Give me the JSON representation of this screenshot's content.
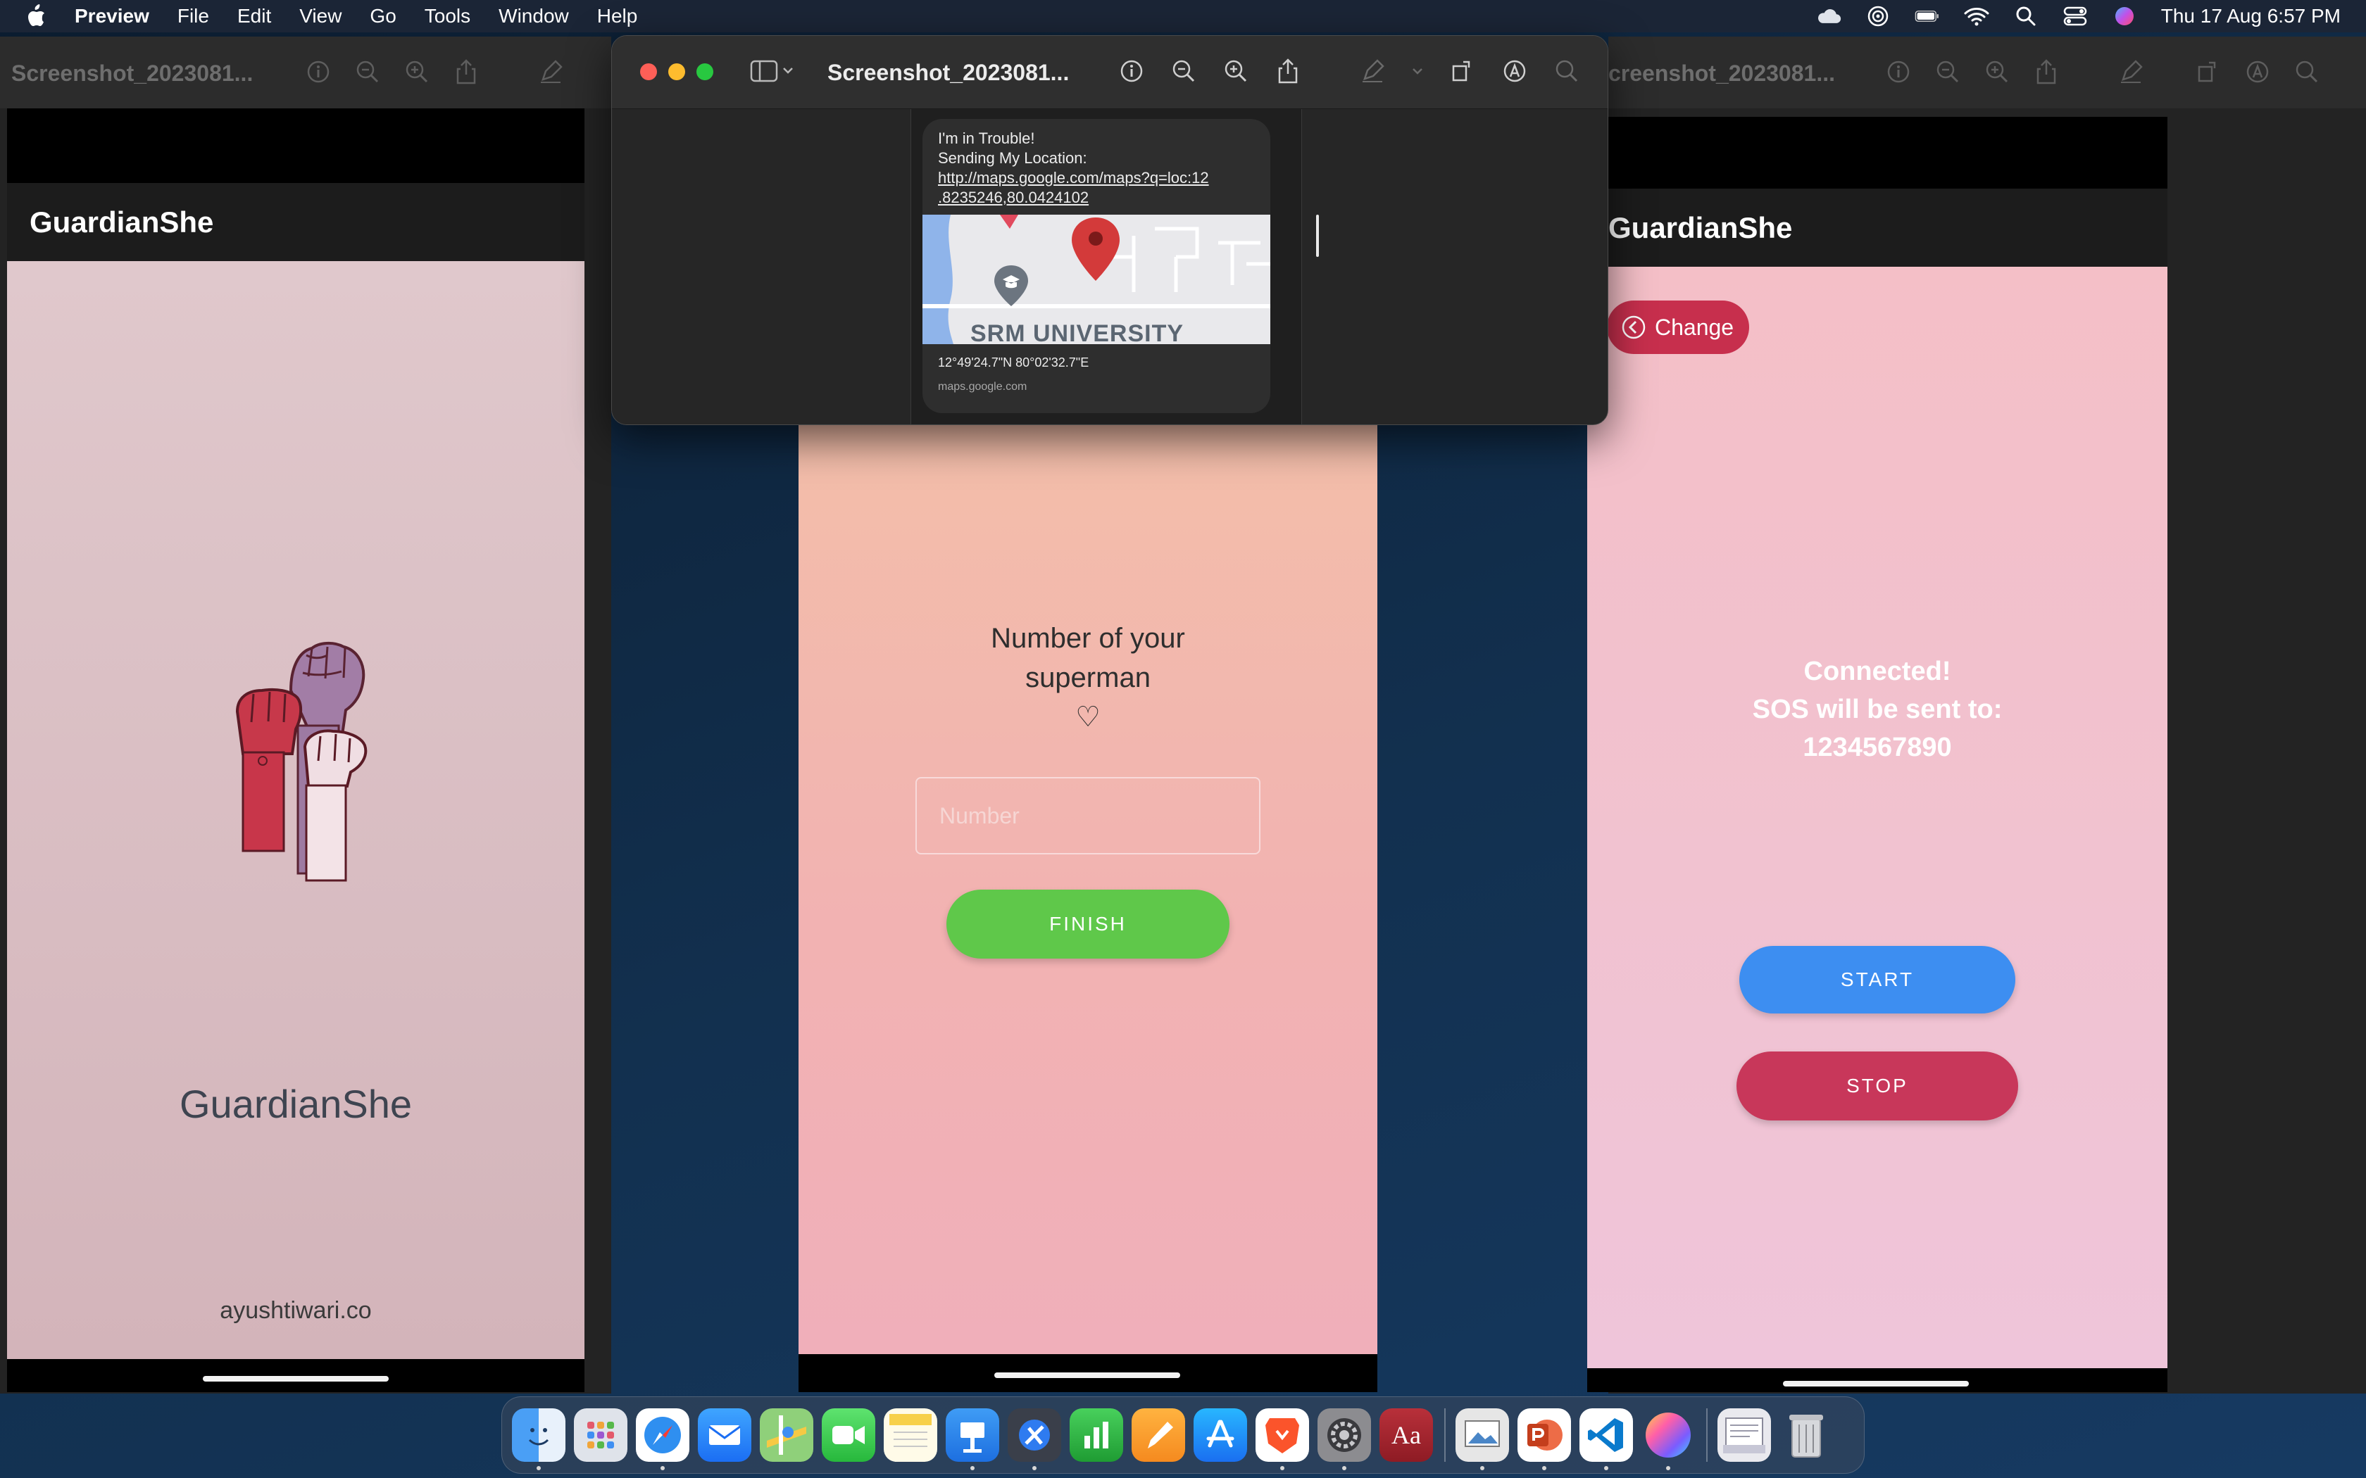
{
  "menubar": {
    "app_name": "Preview",
    "items": [
      "File",
      "Edit",
      "View",
      "Go",
      "Tools",
      "Window",
      "Help"
    ],
    "clock": "Thu 17 Aug  6:57 PM"
  },
  "windows": {
    "left_title": "Screenshot_2023081...",
    "front_title": "Screenshot_2023081...",
    "right_title": "creenshot_2023081..."
  },
  "message": {
    "line1": "I'm in Trouble!",
    "line2": "Sending My Location:",
    "link_line1": "http://maps.google.com/maps?q=loc:12",
    "link_line2": ".8235246,80.0424102",
    "map_label": "SRM UNIVERSITY",
    "coordinates": "12°49'24.7\"N 80°02'32.7\"E",
    "domain": "maps.google.com"
  },
  "phone_left": {
    "appbar_title": "GuardianShe",
    "brand": "GuardianShe",
    "website": "ayushtiwari.co"
  },
  "phone_middle": {
    "heading_line1": "Number of your",
    "heading_line2": "superman",
    "heart": "♡",
    "number_placeholder": "Number",
    "finish_label": "FINISH"
  },
  "phone_right": {
    "appbar_title": "GuardianShe",
    "change_label": "Change",
    "status_line1": "Connected!",
    "status_line2": "SOS will be sent to:",
    "status_number": "1234567890",
    "start_label": "START",
    "stop_label": "STOP"
  },
  "dock": {
    "apps": [
      "finder-icon",
      "launchpad-icon",
      "safari-icon",
      "mail-icon",
      "maps-icon",
      "facetime-icon",
      "notes-icon",
      "keynote-icon",
      "xcode-icon",
      "numbers-icon",
      "pages-icon",
      "app-store-icon",
      "brave-icon",
      "system-settings-icon",
      "dictionary-icon",
      "preview-icon",
      "powerpoint-icon",
      "vscode-icon",
      "color-icon",
      "documents-icon",
      "trash-icon"
    ]
  },
  "colors": {
    "finish": "#5fc84a",
    "start": "#3d8ef1",
    "stop": "#c8375a",
    "change": "#c72f4d"
  }
}
